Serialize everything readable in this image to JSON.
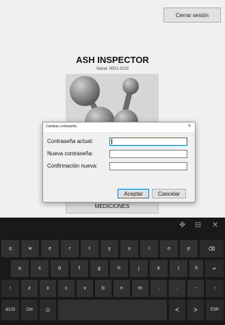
{
  "app": {
    "logout_label": "Cerrar sesión",
    "title": "ASH INSPECTOR",
    "serial": "Serial: 0001-2025",
    "mediciones_label": "MEDICIONES"
  },
  "dialog": {
    "title": "Cambiar contraseña",
    "close_glyph": "×",
    "current_label": "Contraseña actual:",
    "new_label": "Nueva contraseña:",
    "confirm_label": "Confirmación nueva:",
    "current_value": "",
    "new_value": "",
    "confirm_value": "",
    "accept_label": "Aceptar",
    "cancel_label": "Cancelar"
  },
  "keyboard": {
    "toolbar": {
      "move_icon": "✥",
      "dock_icon": "⊟",
      "close_icon": "✕"
    },
    "row1": [
      "q",
      "w",
      "e",
      "r",
      "t",
      "y",
      "u",
      "i",
      "o",
      "p",
      "⌫"
    ],
    "row2": [
      "a",
      "s",
      "d",
      "f",
      "g",
      "h",
      "j",
      "k",
      "l",
      "ñ",
      "↵"
    ],
    "row3": [
      "↑",
      "z",
      "x",
      "c",
      "v",
      "b",
      "n",
      "m",
      ",",
      ".",
      "-",
      "↑"
    ],
    "row4": {
      "symbols": "&123",
      "ctrl": "Ctrl",
      "emoji": "☺",
      "space": "",
      "left": "<",
      "right": ">",
      "lang": "ESP"
    }
  }
}
